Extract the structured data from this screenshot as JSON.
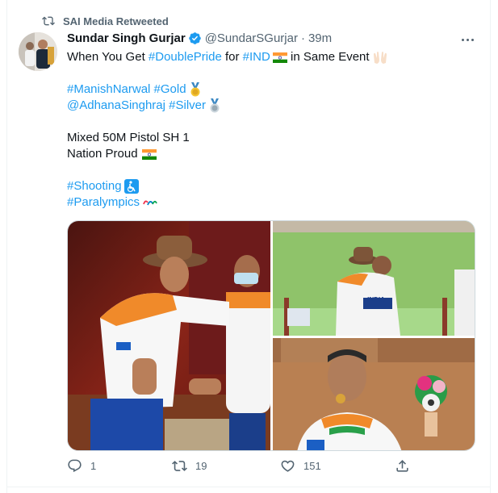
{
  "retweet_context": {
    "label": "SAI Media Retweeted",
    "icon": "retweet-icon"
  },
  "tweet": {
    "author_name": "Sundar Singh Gurjar",
    "author_handle": "@SundarSGurjar",
    "separator": "·",
    "time": "39m",
    "verified": true,
    "lines": {
      "l1_a": "When You Get ",
      "l1_tag1": "#DoublePride",
      "l1_b": " for ",
      "l1_tag2": "#IND",
      "l1_c": " in Same Event",
      "l2_tag1": "#ManishNarwal",
      "l2_sep": " ",
      "l2_tag2": "#Gold",
      "l3_mention": "@AdhanaSinghraj",
      "l3_sep": " ",
      "l3_tag": "#Silver",
      "l4": "Mixed 50M Pistol SH 1",
      "l5": "Nation Proud",
      "l6_tag": "#Shooting",
      "l7_tag": "#Paralympics"
    },
    "media_description": {
      "photo1_icon": "athletes-hugging-photo",
      "photo2_icon": "athletes-embrace-photo",
      "photo2_jersey_text": "INDIA",
      "photo3_icon": "athlete-biting-medal-photo"
    }
  },
  "actions": {
    "reply_count": "1",
    "retweet_count": "19",
    "like_count": "151"
  },
  "colors": {
    "accent": "#1d9bf0",
    "secondary_text": "#536471",
    "primary_text": "#0f1419",
    "verified": "#1d9bf0"
  }
}
